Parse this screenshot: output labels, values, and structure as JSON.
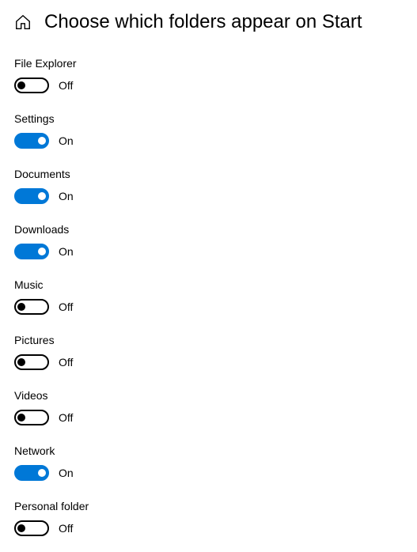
{
  "header": {
    "title": "Choose which folders appear on Start"
  },
  "labels": {
    "on": "On",
    "off": "Off"
  },
  "toggles": [
    {
      "id": "file-explorer",
      "label": "File Explorer",
      "state": false
    },
    {
      "id": "settings",
      "label": "Settings",
      "state": true
    },
    {
      "id": "documents",
      "label": "Documents",
      "state": true
    },
    {
      "id": "downloads",
      "label": "Downloads",
      "state": true
    },
    {
      "id": "music",
      "label": "Music",
      "state": false
    },
    {
      "id": "pictures",
      "label": "Pictures",
      "state": false
    },
    {
      "id": "videos",
      "label": "Videos",
      "state": false
    },
    {
      "id": "network",
      "label": "Network",
      "state": true
    },
    {
      "id": "personal-folder",
      "label": "Personal folder",
      "state": false
    }
  ]
}
